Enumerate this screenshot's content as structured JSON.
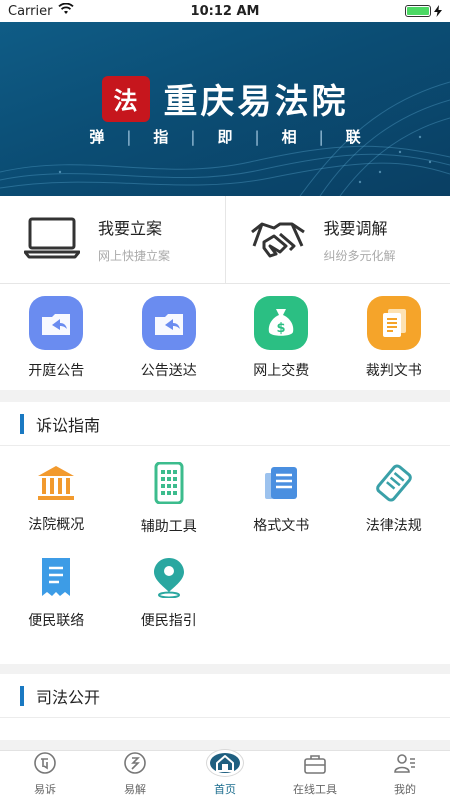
{
  "status_bar": {
    "carrier": "Carrier",
    "time": "10:12 AM",
    "battery_level": 1.0
  },
  "banner": {
    "logo_text": "法",
    "title": "重庆易法院",
    "slogan": [
      "弹",
      "指",
      "即",
      "相",
      "联"
    ]
  },
  "quick_actions": [
    {
      "title": "我要立案",
      "subtitle": "网上快捷立案",
      "icon": "laptop-icon"
    },
    {
      "title": "我要调解",
      "subtitle": "纠纷多元化解",
      "icon": "handshake-icon"
    }
  ],
  "services": [
    {
      "label": "开庭公告",
      "icon": "folder-icon",
      "color": "#6a8cf0"
    },
    {
      "label": "公告送达",
      "icon": "folder-icon",
      "color": "#6a8cf0"
    },
    {
      "label": "网上交费",
      "icon": "money-bag-icon",
      "color": "#2bbf83"
    },
    {
      "label": "裁判文书",
      "icon": "document-icon",
      "color": "#f5a42a"
    }
  ],
  "litigation_guide": {
    "title": "诉讼指南",
    "items": [
      {
        "label": "法院概况",
        "icon": "court-building-icon",
        "color": "#f29a2e"
      },
      {
        "label": "辅助工具",
        "icon": "calculator-phone-icon",
        "color": "#3cbc8d"
      },
      {
        "label": "格式文书",
        "icon": "book-icon",
        "color": "#4a8fe0"
      },
      {
        "label": "法律法规",
        "icon": "scroll-icon",
        "color": "#3aa0a8"
      },
      {
        "label": "便民联络",
        "icon": "receipt-icon",
        "color": "#3d9ce6"
      },
      {
        "label": "便民指引",
        "icon": "location-pin-icon",
        "color": "#2aa7a0"
      }
    ]
  },
  "judicial_public": {
    "title": "司法公开"
  },
  "tabbar": {
    "items": [
      {
        "label": "易诉",
        "icon": "yisu-icon"
      },
      {
        "label": "易解",
        "icon": "yijie-icon"
      },
      {
        "label": "首页",
        "icon": "home-icon",
        "active": true
      },
      {
        "label": "在线工具",
        "icon": "toolbox-icon"
      },
      {
        "label": "我的",
        "icon": "profile-icon"
      }
    ]
  },
  "colors": {
    "accent": "#1a79c2",
    "banner": "#0b4d74",
    "active_tab": "#1c6d8e"
  }
}
